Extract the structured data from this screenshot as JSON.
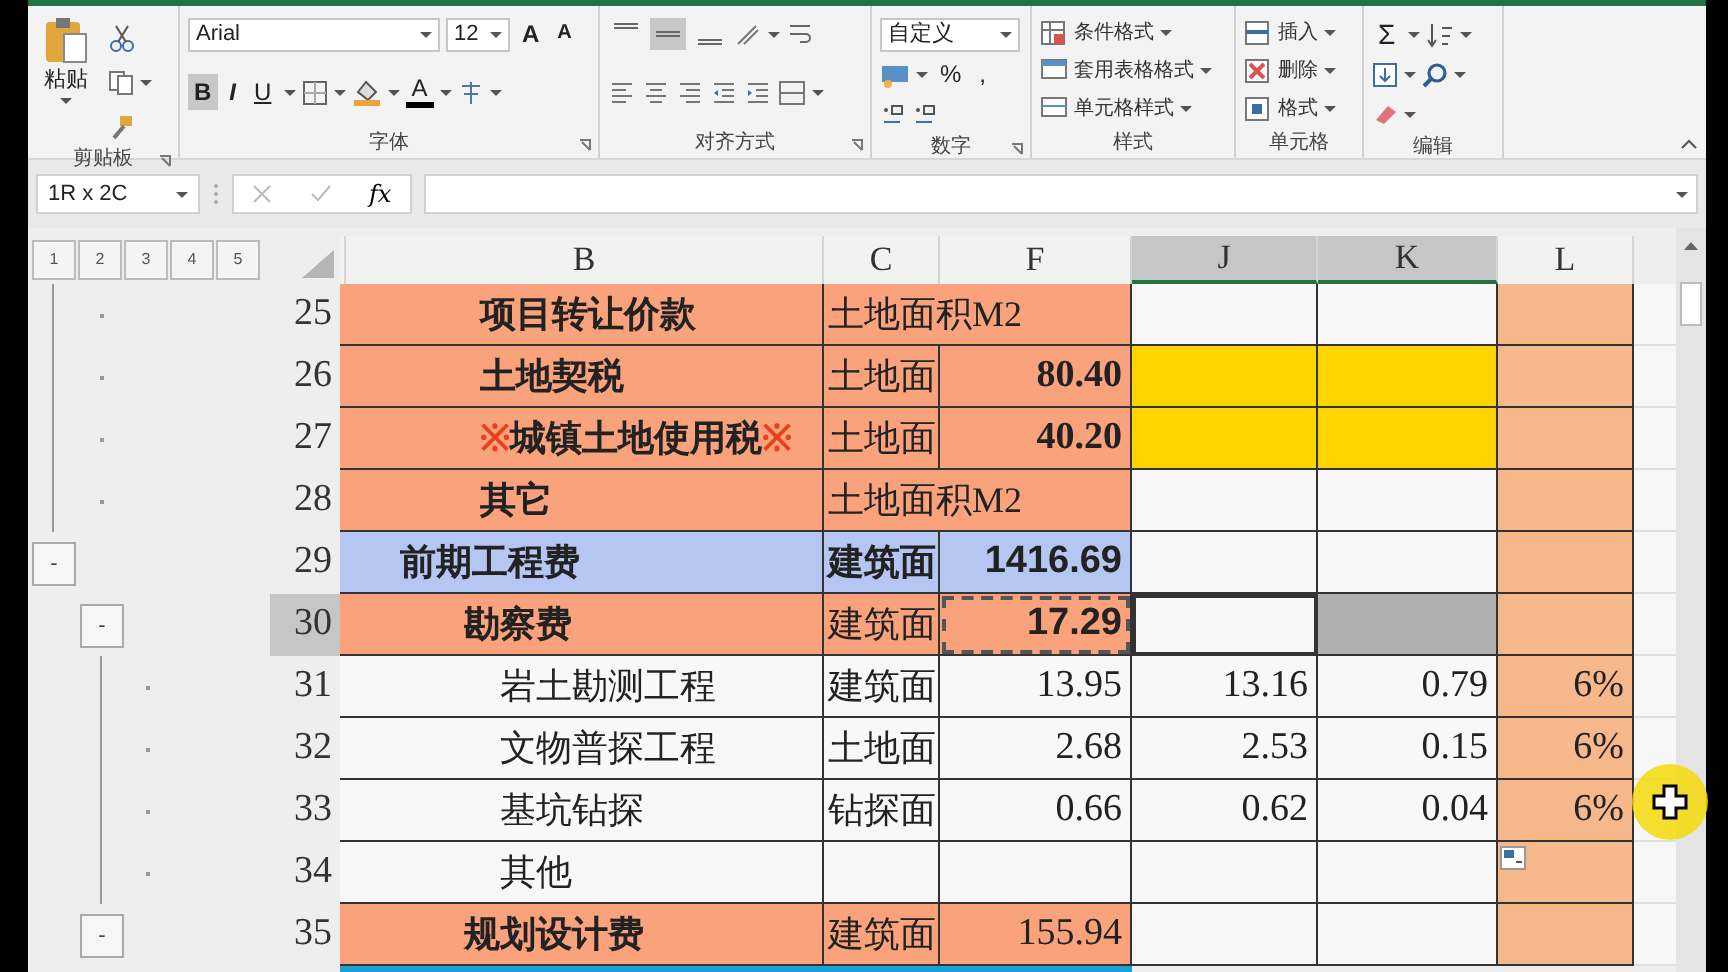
{
  "ribbon": {
    "clipboard": {
      "paste": "粘贴",
      "label": "剪贴板"
    },
    "font": {
      "name": "Arial",
      "size": "12",
      "grow": "A",
      "shrink": "A",
      "bold": "B",
      "italic": "I",
      "underline": "U",
      "color_label": "A",
      "bold_pressed": true,
      "label": "字体"
    },
    "alignment": {
      "vertical": [
        {
          "kind": "top",
          "selected": false
        },
        {
          "kind": "middle",
          "selected": true
        },
        {
          "kind": "bottom",
          "selected": false
        }
      ],
      "label": "对齐方式"
    },
    "number": {
      "format": "自定义",
      "percent": "%",
      "comma": ",",
      "label": "数字"
    },
    "styles": {
      "items": [
        "条件格式",
        "套用表格格式",
        "单元格样式"
      ],
      "label": "样式"
    },
    "cells": {
      "items": [
        "插入",
        "删除",
        "格式"
      ],
      "label": "单元格"
    },
    "editing": {
      "sum": "Σ",
      "label": "编辑"
    }
  },
  "formula_bar": {
    "name_box": "1R x 2C",
    "fx": "fx"
  },
  "sheet": {
    "level_buttons": [
      "1",
      "2",
      "3",
      "4",
      "5"
    ],
    "columns": [
      {
        "letter": "B",
        "selected": false
      },
      {
        "letter": "C",
        "selected": false
      },
      {
        "letter": "F",
        "selected": false
      },
      {
        "letter": "J",
        "selected": true
      },
      {
        "letter": "K",
        "selected": true
      },
      {
        "letter": "L",
        "selected": false
      }
    ],
    "rows": [
      {
        "num": "25",
        "kind": "land",
        "outline": {
          "kind": "group-dot"
        },
        "b": "项目转让价款",
        "c": "土地面积M2",
        "c_overflow": true,
        "jk_highlight": false,
        "selected": false,
        "copied": false
      },
      {
        "num": "26",
        "kind": "land",
        "outline": {
          "kind": "group-dot"
        },
        "b": "土地契税",
        "c": "土地面",
        "f": "80.40",
        "jk_highlight": true,
        "selected": false,
        "copied": false
      },
      {
        "num": "27",
        "kind": "land",
        "outline": {
          "kind": "group-dot"
        },
        "b_before": "※",
        "b": "城镇土地使用税",
        "b_after": "※",
        "c": "土地面",
        "f": "40.20",
        "jk_highlight": true,
        "selected": false,
        "copied": false
      },
      {
        "num": "28",
        "kind": "land",
        "outline": {
          "kind": "group-dot"
        },
        "b": "其它",
        "c": "土地面积M2",
        "c_overflow": true,
        "jk_highlight": false,
        "selected": false,
        "copied": false
      },
      {
        "num": "29",
        "kind": "phase",
        "outline": {
          "kind": "group-toggle"
        },
        "toggle": "-",
        "b": "前期工程费",
        "c": "建筑面",
        "f": "1416.69",
        "jk_highlight": false,
        "selected": false,
        "copied": false
      },
      {
        "num": "30",
        "kind": "cost",
        "outline": {
          "kind": "subgroup-toggle"
        },
        "toggle": "-",
        "b": "勘察费",
        "c": "建筑面",
        "f": "17.29",
        "jk_highlight": false,
        "selected": true,
        "copied": true
      },
      {
        "num": "31",
        "kind": "item",
        "outline": {
          "kind": "subgroup-dot"
        },
        "b": "岩土勘测工程",
        "c": "建筑面",
        "f": "13.95",
        "j": "13.16",
        "k": "0.79",
        "l": "6%",
        "jk_highlight": false,
        "selected": false,
        "copied": false
      },
      {
        "num": "32",
        "kind": "item",
        "outline": {
          "kind": "subgroup-dot"
        },
        "b": "文物普探工程",
        "c": "土地面",
        "f": "2.68",
        "j": "2.53",
        "k": "0.15",
        "l": "6%",
        "jk_highlight": false,
        "selected": false,
        "copied": false
      },
      {
        "num": "33",
        "kind": "item",
        "outline": {
          "kind": "subgroup-dot"
        },
        "b": "基坑钻探",
        "c": "钻探面",
        "f": "0.66",
        "j": "0.62",
        "k": "0.04",
        "l": "6%",
        "jk_highlight": false,
        "selected": false,
        "copied": false
      },
      {
        "num": "34",
        "kind": "item",
        "outline": {
          "kind": "subgroup-dot"
        },
        "b": "其他",
        "jk_highlight": false,
        "selected": false,
        "copied": false,
        "paste_options": true
      },
      {
        "num": "35",
        "kind": "cost",
        "outline": {
          "kind": "subgroup-toggle"
        },
        "toggle": "-",
        "b": "规划设计费",
        "c": "建筑面",
        "f": "155.94",
        "jk_highlight": false,
        "selected": false,
        "copied": false
      }
    ]
  }
}
